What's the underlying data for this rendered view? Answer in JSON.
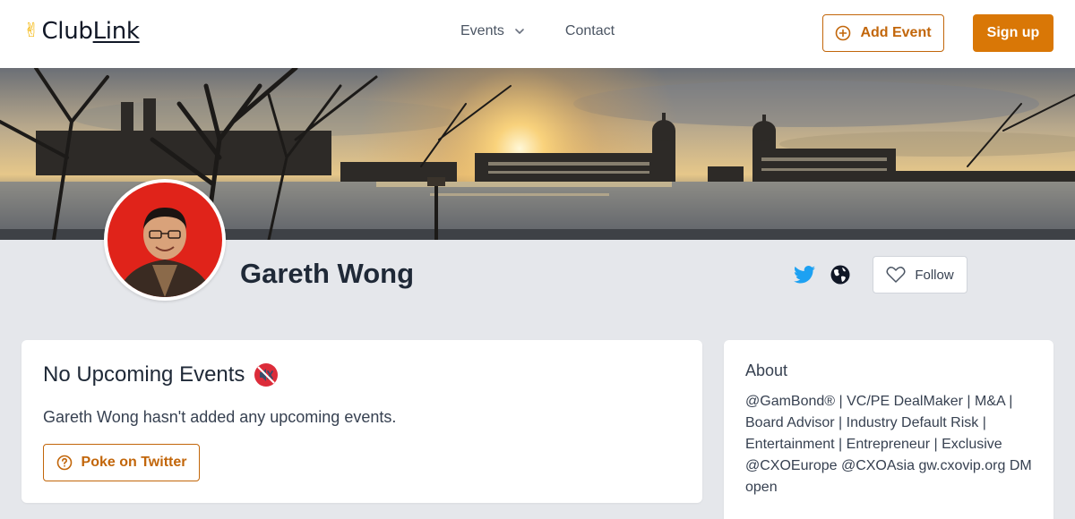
{
  "header": {
    "logo_emoji": "✌",
    "logo_club": "Club",
    "logo_link": "Link",
    "nav": {
      "events_label": "Events",
      "contact_label": "Contact"
    },
    "add_event_label": "Add Event",
    "signup_label": "Sign up"
  },
  "profile": {
    "name": "Gareth Wong",
    "follow_label": "Follow",
    "social_icons": [
      "twitter-icon",
      "globe-icon"
    ]
  },
  "events": {
    "title": "No Upcoming Events",
    "title_icon": "muted-speaker-icon",
    "message": "Gareth Wong hasn't added any upcoming events.",
    "poke_label": "Poke on Twitter"
  },
  "about": {
    "title": "About",
    "text": "@GamBond® | VC/PE DealMaker | M&A | Board Advisor | Industry Default Risk | Entertainment | Entrepreneur | Exclusive @CXOEurope @CXOAsia gw.cxovip.org DM open"
  },
  "colors": {
    "accent": "#d97706",
    "accent_outline": "#c2660a",
    "twitter": "#1da1f2",
    "page_bg": "#e5e7eb"
  }
}
